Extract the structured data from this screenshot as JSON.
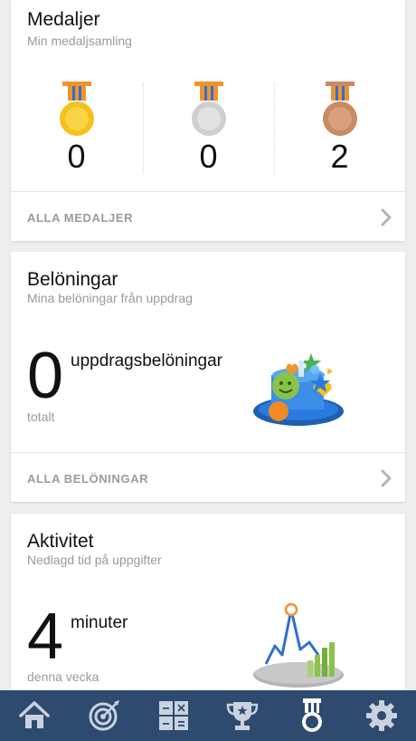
{
  "medals_card": {
    "title": "Medaljer",
    "subtitle": "Min medaljsamling",
    "medals": [
      {
        "type": "gold-medal-icon",
        "count": "0"
      },
      {
        "type": "silver-medal-icon",
        "count": "0"
      },
      {
        "type": "bronze-medal-icon",
        "count": "2"
      }
    ],
    "footer_label": "ALLA MEDALJER"
  },
  "rewards_card": {
    "title": "Belöningar",
    "subtitle": "Mina belöningar från uppdrag",
    "count": "0",
    "unit": "uppdragsbelöningar",
    "note": "totalt",
    "footer_label": "ALLA BELÖNINGAR"
  },
  "activity_card": {
    "title": "Aktivitet",
    "subtitle": "Nedlagd tid på uppgifter",
    "count": "4",
    "unit": "minuter",
    "note": "denna vecka"
  },
  "tabbar": {
    "active_tab": "medals",
    "tabs": [
      "home-icon",
      "target-icon",
      "calculator-icon",
      "trophy-icon",
      "medal-icon",
      "gear-icon"
    ]
  },
  "colors": {
    "tabbar_bg": "#2e4a6e",
    "tab_icon": "#c9d3e0",
    "gold": "#f4c21a",
    "silver": "#cfcfcf",
    "bronze": "#c98a64",
    "ribbon_blue": "#2f6fd0",
    "ribbon_orange": "#f0932b"
  }
}
